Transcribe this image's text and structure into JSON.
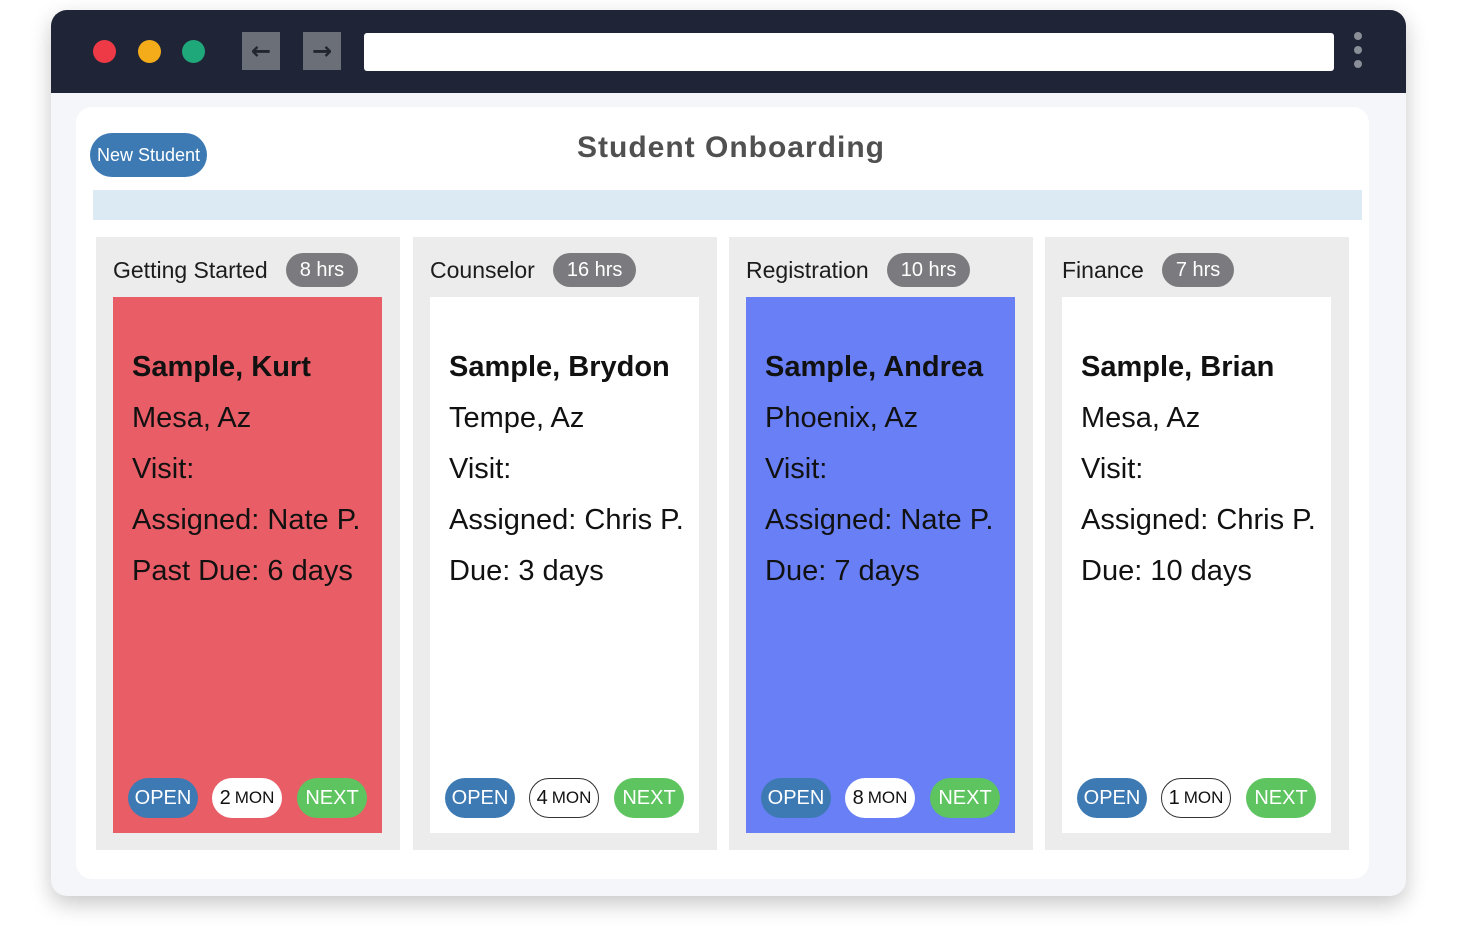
{
  "browser": {
    "back_icon": "←",
    "forward_icon": "→",
    "url": ""
  },
  "header": {
    "new_student_label": "New Student",
    "title": "Student Onboarding"
  },
  "columns": [
    {
      "title": "Getting Started",
      "hours": "8 hrs",
      "card": {
        "color": "#e85d66",
        "name": "Sample, Kurt",
        "city": "Mesa, Az",
        "visit": "Visit:",
        "assigned": "Assigned: Nate P.",
        "due": "Past Due: 6 days",
        "open_label": "OPEN",
        "mon_count": "2",
        "mon_unit": "MON",
        "next_label": "NEXT"
      }
    },
    {
      "title": "Counselor",
      "hours": "16 hrs",
      "card": {
        "color": "#ffffff",
        "name": "Sample, Brydon",
        "city": "Tempe, Az",
        "visit": "Visit:",
        "assigned": "Assigned: Chris P.",
        "due": "Due: 3 days",
        "open_label": "OPEN",
        "mon_count": "4",
        "mon_unit": "MON",
        "next_label": "NEXT"
      }
    },
    {
      "title": "Registration",
      "hours": "10 hrs",
      "card": {
        "color": "#687ff5",
        "name": "Sample, Andrea",
        "city": "Phoenix, Az",
        "visit": "Visit:",
        "assigned": "Assigned: Nate P.",
        "due": "Due: 7 days",
        "open_label": "OPEN",
        "mon_count": "8",
        "mon_unit": "MON",
        "next_label": "NEXT"
      }
    },
    {
      "title": "Finance",
      "hours": "7 hrs",
      "card": {
        "color": "#ffffff",
        "name": "Sample, Brian",
        "city": "Mesa, Az",
        "visit": "Visit:",
        "assigned": "Assigned: Chris P.",
        "due": "Due: 10 days",
        "open_label": "OPEN",
        "mon_count": "1",
        "mon_unit": "MON",
        "next_label": "NEXT"
      }
    }
  ],
  "colors": {
    "titlebar": "#1f2536",
    "open": "#3d7ab3",
    "next": "#5dc45f",
    "hours_badge": "#7b7b7f"
  }
}
